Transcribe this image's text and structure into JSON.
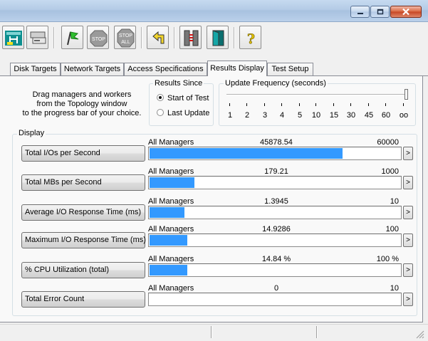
{
  "window": {
    "controls": [
      "minimize",
      "maximize",
      "close"
    ]
  },
  "toolbar": {
    "icons": [
      "topology-icon",
      "disk-icon",
      "start-flag-icon",
      "stop-icon",
      "stop-all-icon",
      "reset-icon",
      "network-icon",
      "exit-icon",
      "help-icon"
    ],
    "stop_label": "STOP",
    "stop_all_label_1": "STOP",
    "stop_all_label_2": "ALL",
    "help_glyph": "?"
  },
  "tabs": [
    {
      "label": "Disk Targets",
      "active": false
    },
    {
      "label": "Network Targets",
      "active": false
    },
    {
      "label": "Access Specifications",
      "active": false
    },
    {
      "label": "Results Display",
      "active": true
    },
    {
      "label": "Test Setup",
      "active": false
    }
  ],
  "instructions": {
    "line1": "Drag managers and workers",
    "line2": "from the Topology window",
    "line3": "to the progress bar of your choice."
  },
  "results_since": {
    "title": "Results Since",
    "options": [
      {
        "label": "Start of Test",
        "selected": true
      },
      {
        "label": "Last Update",
        "selected": false
      }
    ]
  },
  "update_frequency": {
    "title": "Update Frequency (seconds)",
    "ticks": [
      "1",
      "2",
      "3",
      "4",
      "5",
      "10",
      "15",
      "30",
      "45",
      "60",
      "oo"
    ],
    "selected": "oo"
  },
  "display": {
    "title": "Display",
    "rows": [
      {
        "button": "Total I/Os per Second",
        "source": "All Managers",
        "value": "45878.54",
        "max": "60000",
        "fill_fraction": 0.7646
      },
      {
        "button": "Total MBs per Second",
        "source": "All Managers",
        "value": "179.21",
        "max": "1000",
        "fill_fraction": 0.1792
      },
      {
        "button": "Average I/O Response Time (ms)",
        "source": "All Managers",
        "value": "1.3945",
        "max": "10",
        "fill_fraction": 0.1395
      },
      {
        "button": "Maximum I/O Response Time (ms)",
        "source": "All Managers",
        "value": "14.9286",
        "max": "100",
        "fill_fraction": 0.1493
      },
      {
        "button": "% CPU Utilization (total)",
        "source": "All Managers",
        "value": "14.84 %",
        "max": "100 %",
        "fill_fraction": 0.1484
      },
      {
        "button": "Total Error Count",
        "source": "All Managers",
        "value": "0",
        "max": "10",
        "fill_fraction": 0
      }
    ],
    "arrow_label": ">"
  },
  "colors": {
    "bar_fill": "#3399ff",
    "close_button": "#c64523"
  }
}
